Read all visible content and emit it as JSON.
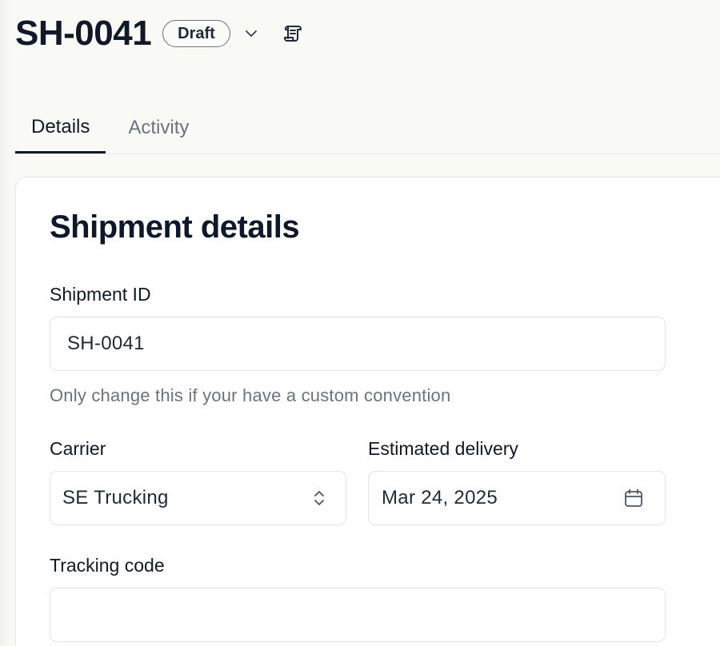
{
  "header": {
    "title": "SH-0041",
    "status": "Draft",
    "status_menu_icon": "chevron-down-icon",
    "log_icon": "scroll-icon"
  },
  "tabs": [
    {
      "label": "Details",
      "active": true
    },
    {
      "label": "Activity",
      "active": false
    }
  ],
  "form": {
    "title": "Shipment details",
    "shipment_id": {
      "label": "Shipment ID",
      "value": "SH-0041",
      "hint": "Only change this if your have a custom convention"
    },
    "carrier": {
      "label": "Carrier",
      "value": "SE Trucking",
      "icon": "chevron-up-down-icon"
    },
    "estimated_delivery": {
      "label": "Estimated delivery",
      "value": "Mar 24, 2025",
      "icon": "calendar-icon"
    },
    "tracking_code": {
      "label": "Tracking code",
      "value": ""
    }
  },
  "colors": {
    "background": "#f9f9f6",
    "text": "#111827",
    "muted": "#6b7280",
    "border": "#e2e4e8"
  }
}
